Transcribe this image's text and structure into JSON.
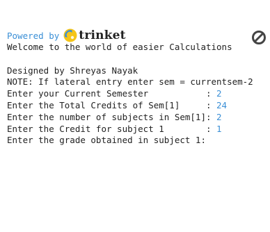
{
  "header": {
    "powered_by": "Powered by",
    "brand": "trinket",
    "logo_icon": "trinket-logo-icon",
    "stop_icon": "stop-icon",
    "brand_yellow": "#f5c518",
    "link_blue": "#3a8fd6"
  },
  "console": {
    "lines": [
      "Welcome to the world of easier Calculations",
      "",
      "Designed by Shreyas Nayak",
      "NOTE: If lateral entry enter sem = currentsem-2"
    ],
    "prompts": [
      {
        "label": "Enter your Current Semester           : ",
        "value": "2"
      },
      {
        "label": "Enter the Total Credits of Sem[1]     : ",
        "value": "24"
      },
      {
        "label": "Enter the number of subjects in Sem[1]: ",
        "value": "2"
      },
      {
        "label": "Enter the Credit for subject 1        : ",
        "value": "1"
      }
    ],
    "current_prompt": "Enter the grade obtained in subject 1: "
  }
}
